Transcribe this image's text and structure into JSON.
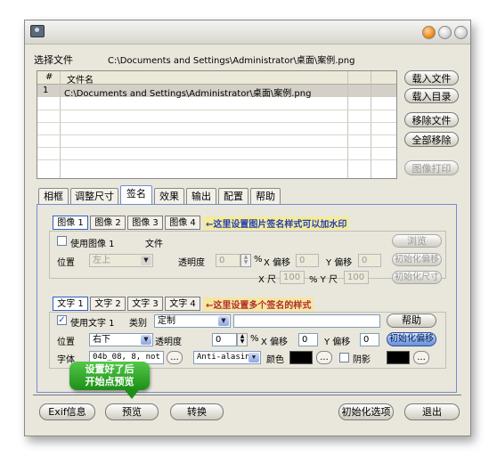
{
  "window": {
    "title": ""
  },
  "file": {
    "label": "选择文件",
    "path": "C:\\Documents and Settings\\Administrator\\桌面\\案例.png",
    "table": {
      "headers": [
        "#",
        "文件名"
      ],
      "rows": [
        {
          "num": "1",
          "name": "C:\\Documents and Settings\\Administrator\\桌面\\案例.png"
        }
      ]
    }
  },
  "side_buttons": {
    "load_file": "载入文件",
    "load_dir": "载入目录",
    "remove_file": "移除文件",
    "remove_all": "全部移除",
    "print_image": "图像打印"
  },
  "tabs": [
    "相框",
    "调整尺寸",
    "签名",
    "效果",
    "输出",
    "配置",
    "帮助"
  ],
  "selected_tab": "签名",
  "image_sign": {
    "subtabs": [
      "图像 1",
      "图像 2",
      "图像 3",
      "图像 4"
    ],
    "callout": "←这里设置图片签名样式可以加水印",
    "use_label": "使用图像 1",
    "file_label": "文件",
    "browse": "浏览",
    "position_label": "位置",
    "position_value": "左上",
    "opacity_label": "透明度",
    "opacity_value": "0",
    "percent": "%",
    "x_offset_label": "X 偏移",
    "x_offset_value": "0",
    "y_offset_label": "Y 偏移",
    "y_offset_value": "0",
    "x_size_label": "X 尺",
    "x_size_value": "100",
    "y_size_label": "% Y 尺",
    "y_size_value": "100",
    "init_offset": "初始化偏移",
    "init_size": "初始化尺寸"
  },
  "text_sign": {
    "subtabs": [
      "文字 1",
      "文字 2",
      "文字 3",
      "文字 4"
    ],
    "callout": "←这里设置多个签名的样式",
    "use_label": "使用文字 1",
    "category_label": "类别",
    "category_value": "定制",
    "help": "帮助",
    "position_label": "位置",
    "position_value": "右下",
    "opacity_label": "透明度",
    "opacity_value": "0",
    "percent": "%",
    "x_offset_label": "X 偏移",
    "x_offset_value": "0",
    "y_offset_label": "Y 偏移",
    "y_offset_value": "0",
    "init_offset": "初始化偏移",
    "font_label": "字体",
    "font_value": "04b_08, 8, not",
    "antialias_value": "Anti-alasin",
    "color_label": "颜色",
    "shadow_label": "阴影",
    "ellipsis": "..."
  },
  "bottom": {
    "exif": "Exif信息",
    "preview": "预览",
    "convert": "转换",
    "init_options": "初始化选项",
    "exit": "退出",
    "bubble": [
      "设置好了后",
      "开始点预览"
    ]
  },
  "colors": {
    "accent": "#6f8fcf",
    "callout": "#2a3fb5",
    "bubble": "#1d8f18"
  }
}
